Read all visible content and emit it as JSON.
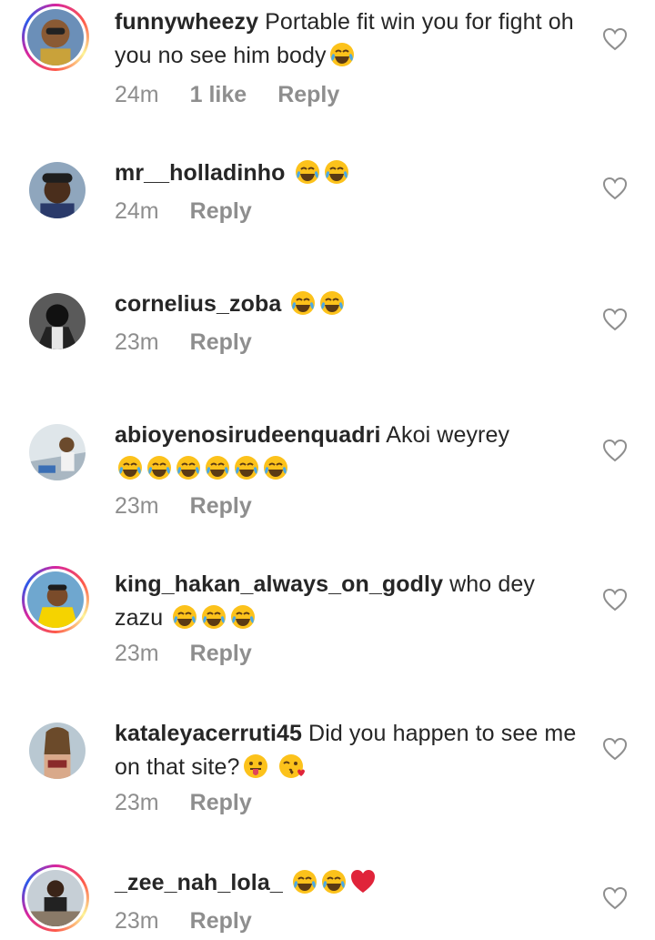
{
  "comments": [
    {
      "username": "funnywheezy",
      "text": " Portable fit win you for fight oh you no see him body",
      "emojis": [
        "joy"
      ],
      "time": "24m",
      "likes": "1 like",
      "reply": "Reply",
      "ring": true
    },
    {
      "username": "mr__holladinho",
      "text": "",
      "emojis": [
        "joy",
        "joy"
      ],
      "time": "24m",
      "likes": "",
      "reply": "Reply",
      "ring": false
    },
    {
      "username": "cornelius_zoba",
      "text": "",
      "emojis": [
        "joy",
        "joy"
      ],
      "time": "23m",
      "likes": "",
      "reply": "Reply",
      "ring": false
    },
    {
      "username": "abioyenosirudeenquadri",
      "text": " Akoi weyrey",
      "emojis": [
        "joy",
        "joy",
        "joy",
        "joy",
        "joy",
        "joy"
      ],
      "time": "23m",
      "likes": "",
      "reply": "Reply",
      "ring": false
    },
    {
      "username": "king_hakan_always_on_godly",
      "text": " who dey zazu",
      "emojis": [
        "joy",
        "joy",
        "joy"
      ],
      "time": "23m",
      "likes": "",
      "reply": "Reply",
      "ring": true
    },
    {
      "username": "kataleyacerruti45",
      "text": " Did you happen to see me on that site?",
      "emojis": [
        "tongue",
        "kiss"
      ],
      "time": "23m",
      "likes": "",
      "reply": "Reply",
      "ring": false
    },
    {
      "username": "_zee_nah_lola_",
      "text": "",
      "emojis": [
        "joy",
        "joy",
        "heart"
      ],
      "time": "23m",
      "likes": "",
      "reply": "Reply",
      "ring": true
    }
  ],
  "colors": {
    "text": "#262626",
    "meta": "#8e8e8e",
    "heart_stroke": "#8e8e8e"
  },
  "icons": {
    "like": "heart-outline-icon",
    "joy": "face-with-tears-of-joy-icon",
    "tongue": "face-with-tongue-icon",
    "kiss": "face-blowing-kiss-icon",
    "heart": "red-heart-icon"
  }
}
